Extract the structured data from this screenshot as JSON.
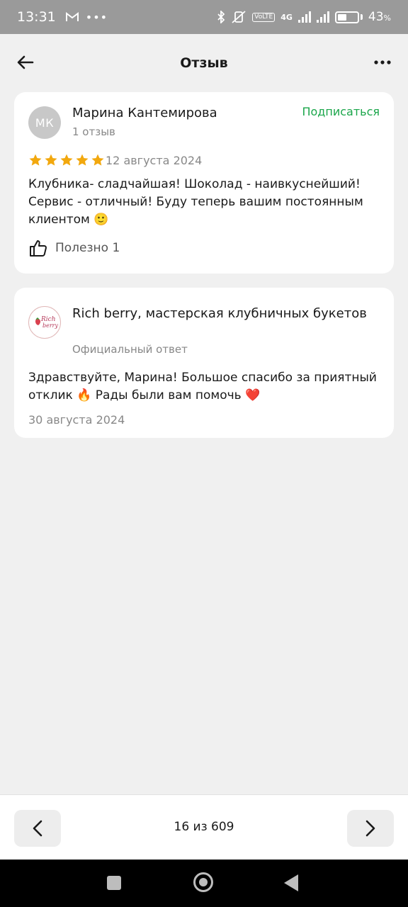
{
  "status_bar": {
    "time": "13:31",
    "battery": "43",
    "battery_unit": "%",
    "network": "4G",
    "volte": "VoLTE"
  },
  "header": {
    "title": "Отзыв",
    "back_icon": "arrow-left-icon",
    "more_icon": "more-horizontal-icon"
  },
  "review": {
    "avatar_initials": "МК",
    "author": "Марина Кантемирова",
    "author_reviews": "1 отзыв",
    "subscribe_label": "Подписаться",
    "rating": 5,
    "rating_max": 5,
    "date": "12 августа 2024",
    "text": "Клубника- сладчайшая! Шоколад - наивкуснейший! Сервис - отличный! Буду теперь вашим постоянным клиентом 🙂",
    "useful_label": "Полезно",
    "useful_count": "1"
  },
  "reply": {
    "company": "Rich berry, мастерская клубничных букетов",
    "logo_text_1": "Rich",
    "logo_text_2": "berry",
    "subtitle": "Официальный ответ",
    "text": "Здравствуйте, Марина! Большое спасибо за приятный отклик 🔥 Рады были вам помочь ❤️",
    "date": "30 августа 2024"
  },
  "pager": {
    "label": "16 из 609"
  },
  "colors": {
    "accent_green": "#1aa64a",
    "star": "#f2a80e",
    "background": "#f0f0f0"
  }
}
